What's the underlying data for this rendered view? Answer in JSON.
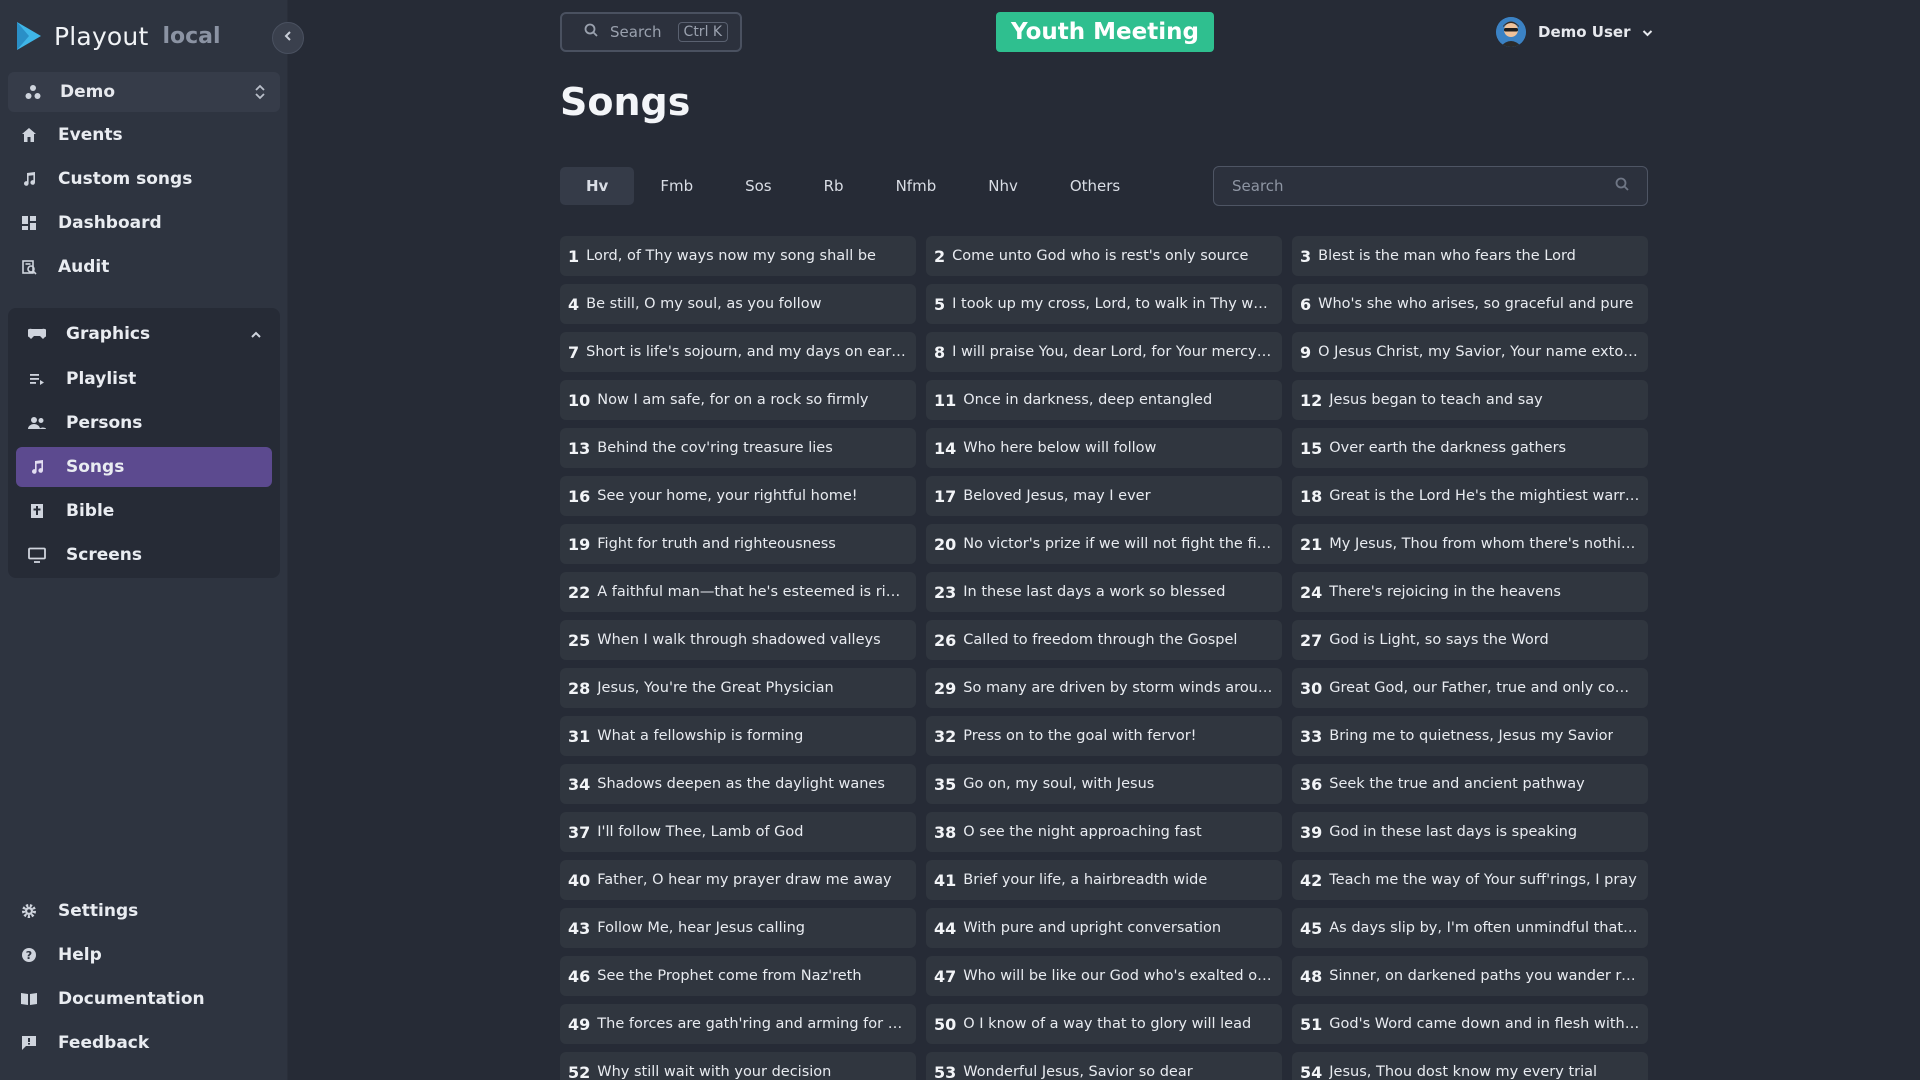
{
  "app": {
    "name": "Playout",
    "env": "local"
  },
  "sidebar": {
    "org": "Demo",
    "nav": [
      {
        "label": "Events",
        "icon": "home-icon"
      },
      {
        "label": "Custom songs",
        "icon": "music-note-icon"
      },
      {
        "label": "Dashboard",
        "icon": "dashboard-icon"
      },
      {
        "label": "Audit",
        "icon": "audit-icon"
      }
    ],
    "graphics": {
      "label": "Graphics",
      "items": [
        {
          "label": "Playlist",
          "icon": "playlist-icon"
        },
        {
          "label": "Persons",
          "icon": "people-icon"
        },
        {
          "label": "Songs",
          "icon": "music-note-icon",
          "active": true
        },
        {
          "label": "Bible",
          "icon": "bible-icon"
        },
        {
          "label": "Screens",
          "icon": "monitor-icon"
        }
      ]
    },
    "footer": [
      {
        "label": "Settings",
        "icon": "gear-icon"
      },
      {
        "label": "Help",
        "icon": "help-icon"
      },
      {
        "label": "Documentation",
        "icon": "book-icon"
      },
      {
        "label": "Feedback",
        "icon": "feedback-icon"
      }
    ]
  },
  "header": {
    "search_placeholder": "Search",
    "search_shortcut": "Ctrl K",
    "event": "Youth Meeting",
    "user": "Demo User"
  },
  "page": {
    "title": "Songs",
    "tabs": [
      "Hv",
      "Fmb",
      "Sos",
      "Rb",
      "Nfmb",
      "Nhv",
      "Others"
    ],
    "selected_tab": "Hv",
    "search_placeholder": "Search"
  },
  "colors": {
    "accent": "#5c4a8f",
    "event": "#2fbf8f",
    "background": "#262b36",
    "sidebar": "#2e3440"
  },
  "songs": [
    {
      "n": "1",
      "t": "Lord, of Thy ways now my song shall be"
    },
    {
      "n": "2",
      "t": "Come unto God who is rest's only source"
    },
    {
      "n": "3",
      "t": "Blest is the man who fears the Lord"
    },
    {
      "n": "4",
      "t": "Be still, O my soul, as you follow"
    },
    {
      "n": "5",
      "t": "I took up my cross, Lord, to walk in Thy ways"
    },
    {
      "n": "6",
      "t": "Who's she who arises, so graceful and pure"
    },
    {
      "n": "7",
      "t": "Short is life's sojourn, and my days on earth a..."
    },
    {
      "n": "8",
      "t": "I will praise You, dear Lord, for Your mercy unt..."
    },
    {
      "n": "9",
      "t": "O Jesus Christ, my Savior, Your name extolle..."
    },
    {
      "n": "10",
      "t": "Now I am safe, for on a rock so firmly"
    },
    {
      "n": "11",
      "t": "Once in darkness, deep entangled"
    },
    {
      "n": "12",
      "t": "Jesus began to teach and say"
    },
    {
      "n": "13",
      "t": "Behind the cov'ring treasure lies"
    },
    {
      "n": "14",
      "t": "Who here below will follow"
    },
    {
      "n": "15",
      "t": "Over earth the darkness gathers"
    },
    {
      "n": "16",
      "t": "See your home, your rightful home!"
    },
    {
      "n": "17",
      "t": "Beloved Jesus, may I ever"
    },
    {
      "n": "18",
      "t": "Great is the Lord He's the mightiest warrior!"
    },
    {
      "n": "19",
      "t": "Fight for truth and righteousness"
    },
    {
      "n": "20",
      "t": "No victor's prize if we will not fight the fight"
    },
    {
      "n": "21",
      "t": "My Jesus, Thou from whom there's nothing h..."
    },
    {
      "n": "22",
      "t": "A faithful man—that he's esteemed is rightful"
    },
    {
      "n": "23",
      "t": "In these last days a work so blessed"
    },
    {
      "n": "24",
      "t": "There's rejoicing in the heavens"
    },
    {
      "n": "25",
      "t": "When I walk through shadowed valleys"
    },
    {
      "n": "26",
      "t": "Called to freedom through the Gospel"
    },
    {
      "n": "27",
      "t": "God is Light, so says the Word"
    },
    {
      "n": "28",
      "t": "Jesus, You're the Great Physician"
    },
    {
      "n": "29",
      "t": "So many are driven by storm winds around"
    },
    {
      "n": "30",
      "t": "Great God, our Father, true and only comfort"
    },
    {
      "n": "31",
      "t": "What a fellowship is forming"
    },
    {
      "n": "32",
      "t": "Press on to the goal with fervor!"
    },
    {
      "n": "33",
      "t": "Bring me to quietness, Jesus my Savior"
    },
    {
      "n": "34",
      "t": "Shadows deepen as the daylight wanes"
    },
    {
      "n": "35",
      "t": "Go on, my soul, with Jesus"
    },
    {
      "n": "36",
      "t": "Seek the true and ancient pathway"
    },
    {
      "n": "37",
      "t": "I'll follow Thee, Lamb of God"
    },
    {
      "n": "38",
      "t": "O see the night approaching fast"
    },
    {
      "n": "39",
      "t": "God in these last days is speaking"
    },
    {
      "n": "40",
      "t": "Father, O hear my prayer draw me away"
    },
    {
      "n": "41",
      "t": "Brief your life, a hairbreadth wide"
    },
    {
      "n": "42",
      "t": "Teach me the way of Your suff'rings, I pray"
    },
    {
      "n": "43",
      "t": "Follow Me, hear Jesus calling"
    },
    {
      "n": "44",
      "t": "With pure and upright conversation"
    },
    {
      "n": "45",
      "t": "As days slip by, I'm often unmindful that I'll ..."
    },
    {
      "n": "46",
      "t": "See the Prophet come from Naz'reth"
    },
    {
      "n": "47",
      "t": "Who will be like our God who's exalted on hi..."
    },
    {
      "n": "48",
      "t": "Sinner, on darkened paths you wander rou..."
    },
    {
      "n": "49",
      "t": "The forces are gath'ring and arming for war"
    },
    {
      "n": "50",
      "t": "O I know of a way that to glory will lead"
    },
    {
      "n": "51",
      "t": "God's Word came down and in flesh with us ..."
    },
    {
      "n": "52",
      "t": "Why still wait with your decision"
    },
    {
      "n": "53",
      "t": "Wonderful Jesus, Savior so dear"
    },
    {
      "n": "54",
      "t": "Jesus, Thou dost know my every trial"
    }
  ]
}
